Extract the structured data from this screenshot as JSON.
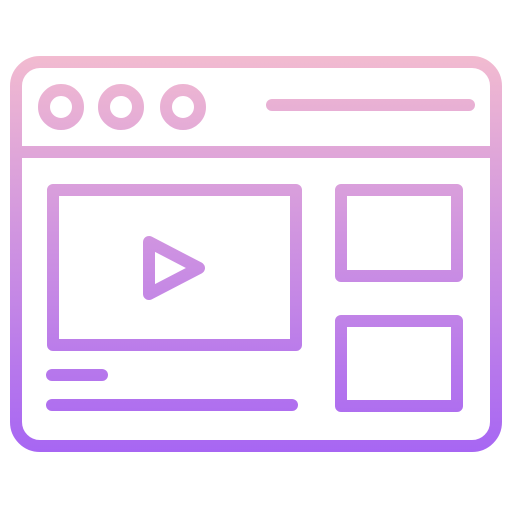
{
  "icon": {
    "name": "video-webpage-icon",
    "gradient": {
      "top_color": "#F2BBD0",
      "bottom_color": "#A766F3"
    }
  }
}
